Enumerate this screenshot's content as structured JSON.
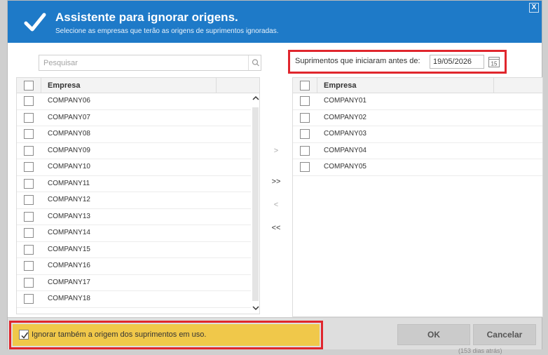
{
  "background": {
    "hint_text": "(153 dias atrás)"
  },
  "header": {
    "title": "Assistente para ignorar origens.",
    "subtitle": "Selecione as empresas que terão as origens de suprimentos ignoradas.",
    "close_label": "X",
    "icon": "checkmark-icon",
    "color": "#1e7ac8"
  },
  "search": {
    "placeholder": "Pesquisar",
    "icon": "search-icon"
  },
  "date_filter": {
    "label": "Suprimentos que iniciaram antes de:",
    "value": "19/05/2026",
    "icon": "calendar-icon"
  },
  "left_grid": {
    "header": "Empresa",
    "rows": [
      "COMPANY06",
      "COMPANY07",
      "COMPANY08",
      "COMPANY09",
      "COMPANY10",
      "COMPANY11",
      "COMPANY12",
      "COMPANY13",
      "COMPANY14",
      "COMPANY15",
      "COMPANY16",
      "COMPANY17",
      "COMPANY18"
    ]
  },
  "right_grid": {
    "header": "Empresa",
    "rows": [
      "COMPANY01",
      "COMPANY02",
      "COMPANY03",
      "COMPANY04",
      "COMPANY05"
    ]
  },
  "move_buttons": {
    "add": ">",
    "add_all": ">>",
    "remove": "<",
    "remove_all": "<<"
  },
  "footer": {
    "option_label": "Ignorar também a origem dos suprimentos em uso.",
    "option_checked": true,
    "ok_label": "OK",
    "cancel_label": "Cancelar",
    "highlight_color": "#e0262d",
    "option_bg": "#f0c84a"
  }
}
